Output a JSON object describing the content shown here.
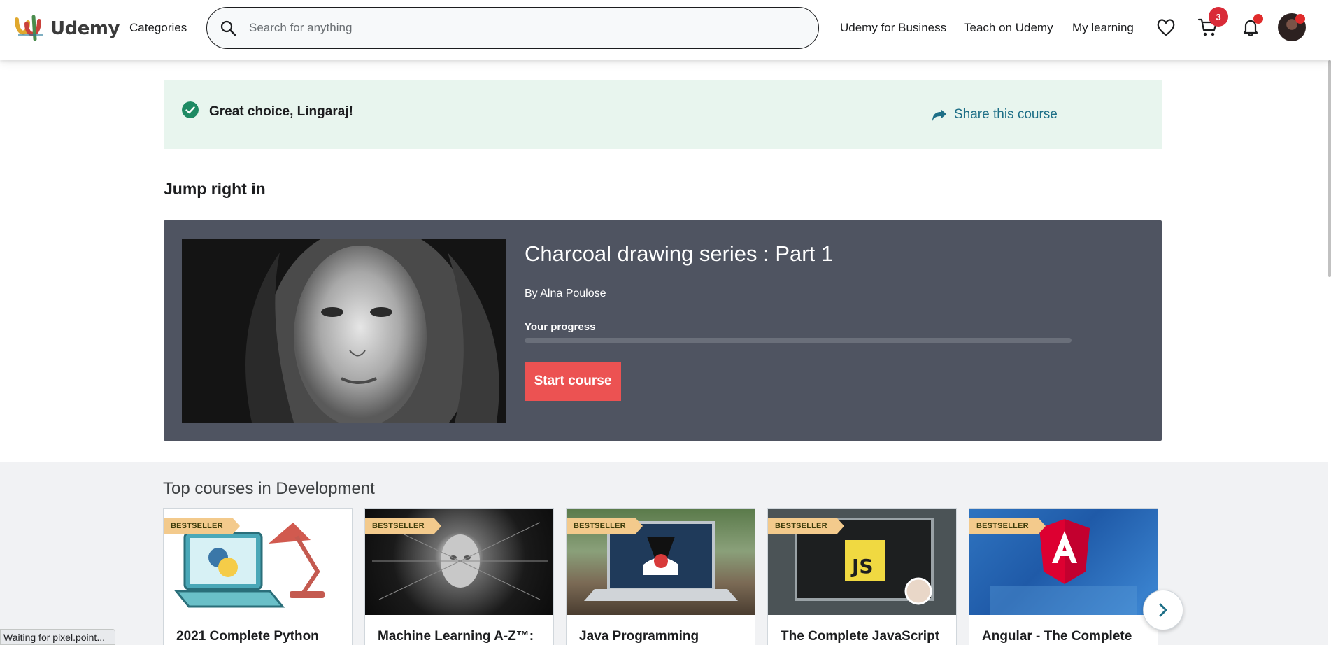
{
  "header": {
    "logo_text": "Udemy",
    "categories_label": "Categories",
    "search_placeholder": "Search for anything",
    "business_link": "Udemy for Business",
    "teach_link": "Teach on Udemy",
    "learning_link": "My learning",
    "cart_count": "3"
  },
  "notice": {
    "message": "Great choice, Lingaraj!",
    "share_label": "Share this course"
  },
  "jump_in": {
    "section_title": "Jump right in",
    "course_title": "Charcoal drawing series : Part 1",
    "author": "By Alna Poulose",
    "progress_label": "Your progress",
    "progress_fraction": 0,
    "start_button": "Start course"
  },
  "top_courses": {
    "title": "Top courses in Development",
    "items": [
      {
        "badge": "BESTSELLER",
        "title": "2021 Complete Python"
      },
      {
        "badge": "BESTSELLER",
        "title": "Machine Learning A-Z™:"
      },
      {
        "badge": "BESTSELLER",
        "title": "Java Programming"
      },
      {
        "badge": "BESTSELLER",
        "title": "The Complete JavaScript"
      },
      {
        "badge": "BESTSELLER",
        "title": "Angular - The Complete"
      }
    ]
  },
  "status_bar": "Waiting for pixel.point...",
  "colors": {
    "accent_red": "#ec5252",
    "notice_bg": "#e8f5ee",
    "link_teal": "#1e6f87",
    "card_bg": "#4f5461",
    "badge_bg": "#f3ca8c"
  }
}
